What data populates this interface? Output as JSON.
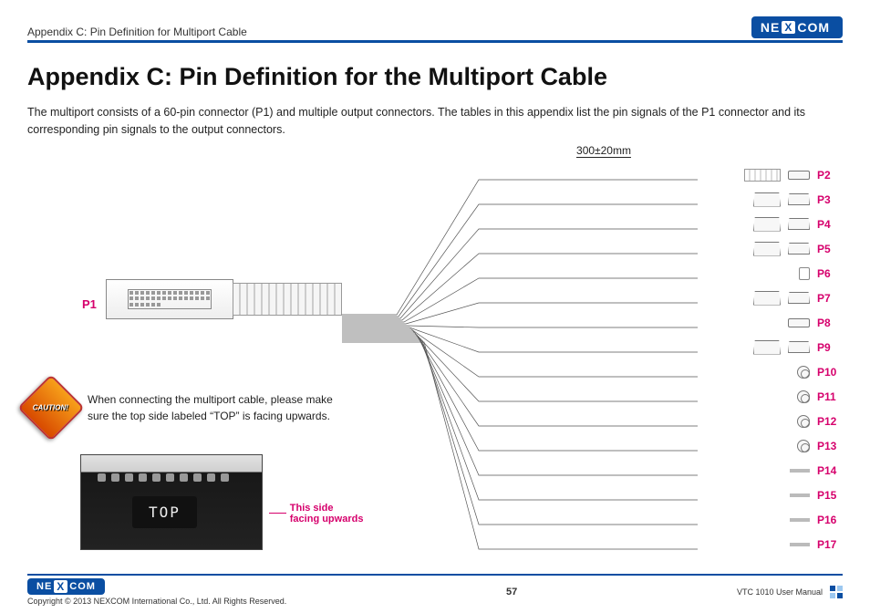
{
  "header": {
    "breadcrumb": "Appendix C: Pin Definition for Multiport Cable",
    "brand": "NEXCOM"
  },
  "title": "Appendix C: Pin Definition for the Multiport Cable",
  "intro": "The multiport consists of a 60-pin connector (P1) and multiple output connectors. The tables in this appendix list the pin signals of the P1 connector and its corresponding pin signals to the output connectors.",
  "diagram": {
    "dimension_label": "300±20mm",
    "source_connector_label": "P1",
    "output_connectors": [
      {
        "label": "P2"
      },
      {
        "label": "P3"
      },
      {
        "label": "P4"
      },
      {
        "label": "P5"
      },
      {
        "label": "P6"
      },
      {
        "label": "P7"
      },
      {
        "label": "P8"
      },
      {
        "label": "P9"
      },
      {
        "label": "P10"
      },
      {
        "label": "P11"
      },
      {
        "label": "P12"
      },
      {
        "label": "P13"
      },
      {
        "label": "P14"
      },
      {
        "label": "P15"
      },
      {
        "label": "P16"
      },
      {
        "label": "P17"
      }
    ]
  },
  "caution": {
    "badge_text": "CAUTION!",
    "message": "When connecting the multiport cable, please make sure the top side labeled “TOP” is facing upwards."
  },
  "photo": {
    "top_label": "TOP",
    "callout": "This side facing upwards"
  },
  "footer": {
    "brand": "NEXCOM",
    "copyright": "Copyright © 2013 NEXCOM International Co., Ltd. All Rights Reserved.",
    "page_number": "57",
    "doc_title": "VTC 1010 User Manual"
  }
}
